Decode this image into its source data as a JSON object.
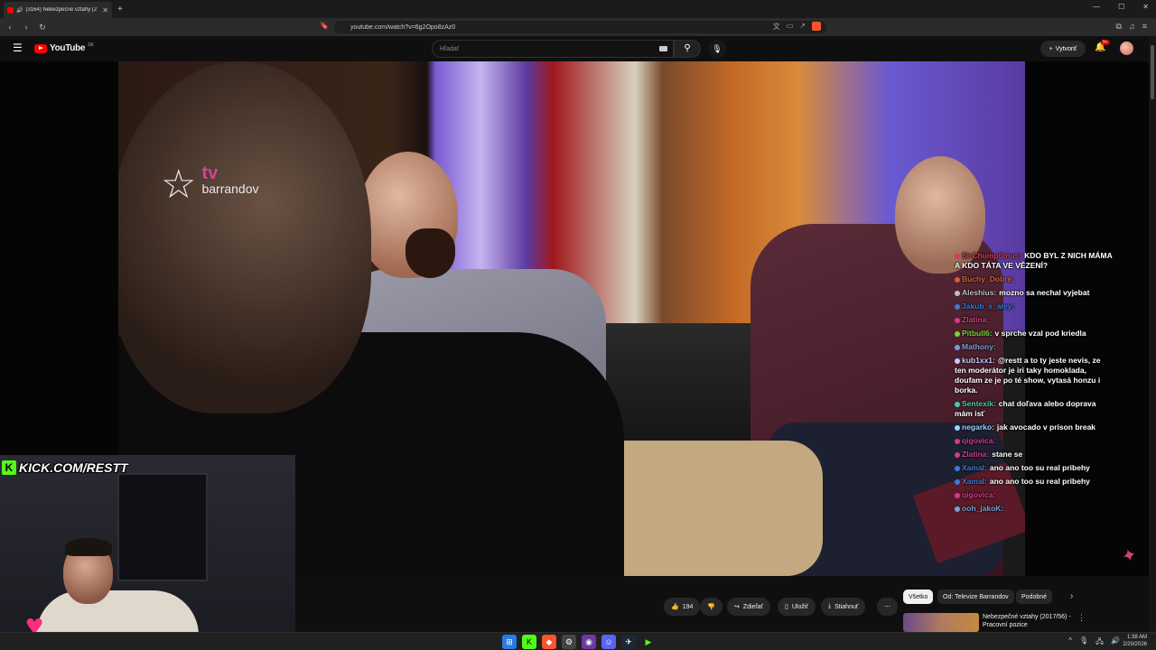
{
  "browser": {
    "tab_title": "(3164) Nebezpečné vztahy (2",
    "url": "youtube.com/watch?v=6g2Opo8zAz0"
  },
  "youtube": {
    "logo_text": "YouTube",
    "logo_region": "SK",
    "search_placeholder": "Hľadať",
    "create_label": "Vytvoriť",
    "notification_badge": "9+"
  },
  "video": {
    "channel_watermark_tv": "tv",
    "channel_watermark_name": "barrandov",
    "stream_overlay": "KICK.COM/RESTT"
  },
  "chat": [
    {
      "user": "SirChumptimus:",
      "text": "KDO BYL Z NICH MÁMA A KDO TÁTA VE VĚZENÍ?",
      "color": "#d43b4f"
    },
    {
      "user": "Buchy_Dobré:",
      "text": "",
      "color": "#d4603b"
    },
    {
      "user": "Aleshius:",
      "text": "mozno sa nechal vyjebat",
      "color": "#c0c0c0"
    },
    {
      "user": "Jakub_s_aley:",
      "text": "",
      "color": "#3b7ad4"
    },
    {
      "user": "Zlatina:",
      "text": "",
      "color": "#d43b8a"
    },
    {
      "user": "Pitbull6:",
      "text": "v sprche vzal pod kriedla",
      "color": "#7ad43b"
    },
    {
      "user": "Mathony:",
      "text": "",
      "color": "#7aa0d4"
    },
    {
      "user": "kub1xx1:",
      "text": "@restt a to ty jeste nevis, ze ten moderátor je iri taky homoklada, doufam ze je po té show, vytasá honzu i borka.",
      "color": "#c8c8ff"
    },
    {
      "user": "Sentexik:",
      "text": "chat doľava alebo doprava mám isť",
      "color": "#4fc8b0"
    },
    {
      "user": "negarko:",
      "text": "jak avocado v prison break",
      "color": "#9ad4ff"
    },
    {
      "user": "qigovica:",
      "text": "",
      "color": "#d43b8a"
    },
    {
      "user": "Zlatina:",
      "text": "stane se",
      "color": "#d43b8a"
    },
    {
      "user": "Xamal:",
      "text": "ano ano too su real pribehy",
      "color": "#3b7ad4"
    },
    {
      "user": "Xamal:",
      "text": "ano ano too su real pribehy",
      "color": "#3b7ad4"
    },
    {
      "user": "qigovica:",
      "text": "",
      "color": "#d43b8a"
    },
    {
      "user": "ooh_jakoK:",
      "text": "",
      "color": "#7aa0d4"
    }
  ],
  "actions": {
    "likes": "194",
    "share": "Zdieľať",
    "save": "Uložiť",
    "download": "Stiahnuť"
  },
  "chips": [
    "Všetko",
    "Od: Televize Barrandov",
    "Podobné"
  ],
  "recommendation": {
    "title": "Nebezpečné vztahy (2017/56) - Pracovní pozice"
  },
  "clock": {
    "time": "1:38 AM",
    "date": "2/20/2026"
  }
}
